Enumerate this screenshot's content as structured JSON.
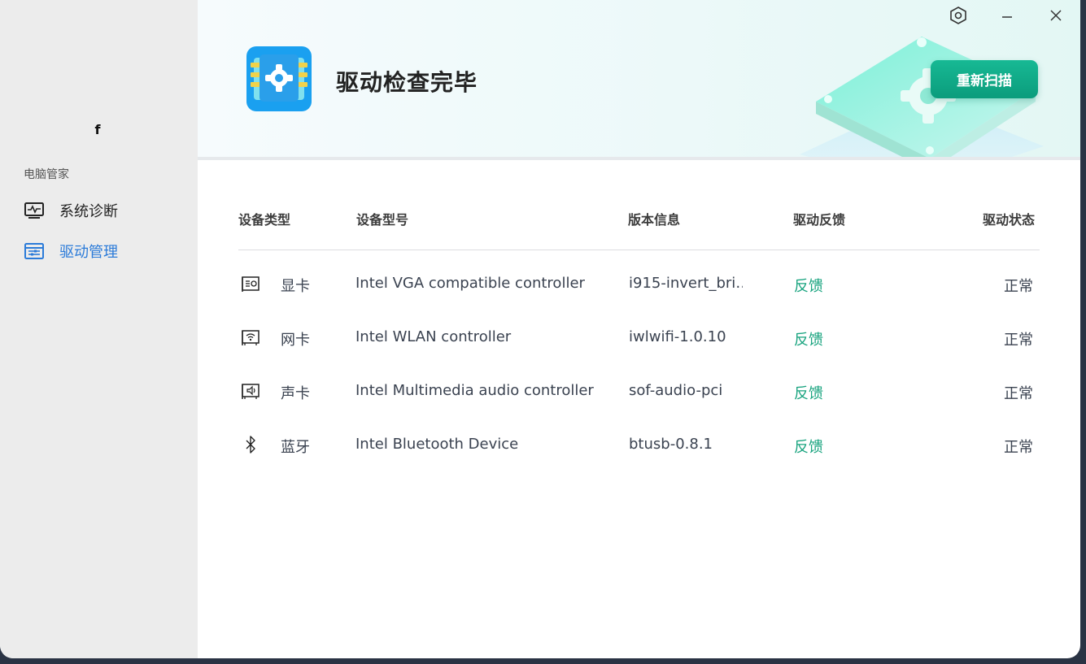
{
  "sidebar": {
    "letter": "f",
    "group_title": "电脑管家",
    "items": [
      {
        "label": "系统诊断",
        "icon": "monitor-pulse-icon"
      },
      {
        "label": "驱动管理",
        "icon": "driver-list-icon",
        "active": true
      }
    ]
  },
  "header": {
    "title": "驱动检查完毕",
    "rescan_label": "重新扫描",
    "logo_icon": "driver-chip-gear-icon"
  },
  "window": {
    "settings_icon": "settings-hex-icon",
    "minimize_icon": "minimize-icon",
    "close_icon": "close-icon"
  },
  "table": {
    "columns": {
      "type": "设备类型",
      "model": "设备型号",
      "version": "版本信息",
      "feedback": "驱动反馈",
      "status": "驱动状态"
    },
    "rows": [
      {
        "icon": "display-card-icon",
        "type": "显卡",
        "model": "Intel VGA compatible controller",
        "version": "i915-invert_bri…",
        "feedback": "反馈",
        "status": "正常"
      },
      {
        "icon": "network-card-icon",
        "type": "网卡",
        "model": "Intel WLAN controller",
        "version": "iwlwifi-1.0.10",
        "feedback": "反馈",
        "status": "正常"
      },
      {
        "icon": "sound-card-icon",
        "type": "声卡",
        "model": "Intel Multimedia audio controller",
        "version": "sof-audio-pci",
        "feedback": "反馈",
        "status": "正常"
      },
      {
        "icon": "bluetooth-icon",
        "type": "蓝牙",
        "model": "Intel Bluetooth Device",
        "version": "btusb-0.8.1",
        "feedback": "反馈",
        "status": "正常"
      }
    ]
  },
  "colors": {
    "accent_blue": "#2b7bd9",
    "accent_green": "#17a37e",
    "button_green": "#0fa886"
  }
}
